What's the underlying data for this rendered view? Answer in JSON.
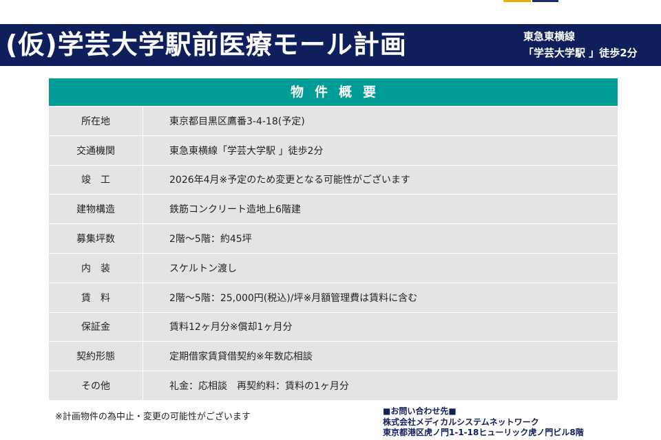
{
  "header": {
    "title": "(仮)学芸大学駅前医療モール計画",
    "line": "東急東横線",
    "access": "「学芸大学駅 」徒歩2分"
  },
  "overview": {
    "heading": "物件概要",
    "rows": [
      {
        "label": "所在地",
        "value": "東京都目黒区鷹番3-4-18(予定)"
      },
      {
        "label": "交通機関",
        "value": "東急東横線「学芸大学駅 」徒歩2分"
      },
      {
        "label": "竣　工",
        "value": "2026年4月※予定のため変更となる可能性がございます"
      },
      {
        "label": "建物構造",
        "value": "鉄筋コンクリート造地上6階建"
      },
      {
        "label": "募集坪数",
        "value": "2階～5階：約45坪"
      },
      {
        "label": "内　装",
        "value": "スケルトン渡し"
      },
      {
        "label": "賃　料",
        "value": "2階～5階：25,000円(税込)/坪※月額管理費は賃料に含む"
      },
      {
        "label": "保証金",
        "value": "賃料12ヶ月分※償却1ヶ月分"
      },
      {
        "label": "契約形態",
        "value": "定期借家賃貸借契約※年数応相談"
      },
      {
        "label": "その他",
        "value": "礼金：応相談　再契約料：賃料の1ヶ月分"
      }
    ]
  },
  "footnote": "※計画物件の為中止・変更の可能性がございます",
  "contact": {
    "heading": "■お問い合わせ先■",
    "company": "株式会社メディカルシステムネットワーク",
    "address": "東京都港区虎ノ門1-1-18ヒューリック虎ノ門ビル8階"
  },
  "colors": {
    "header_bg": "#0f1f5c",
    "table_head_bg": "#009c95",
    "row_bg": "#e4e4e4"
  }
}
